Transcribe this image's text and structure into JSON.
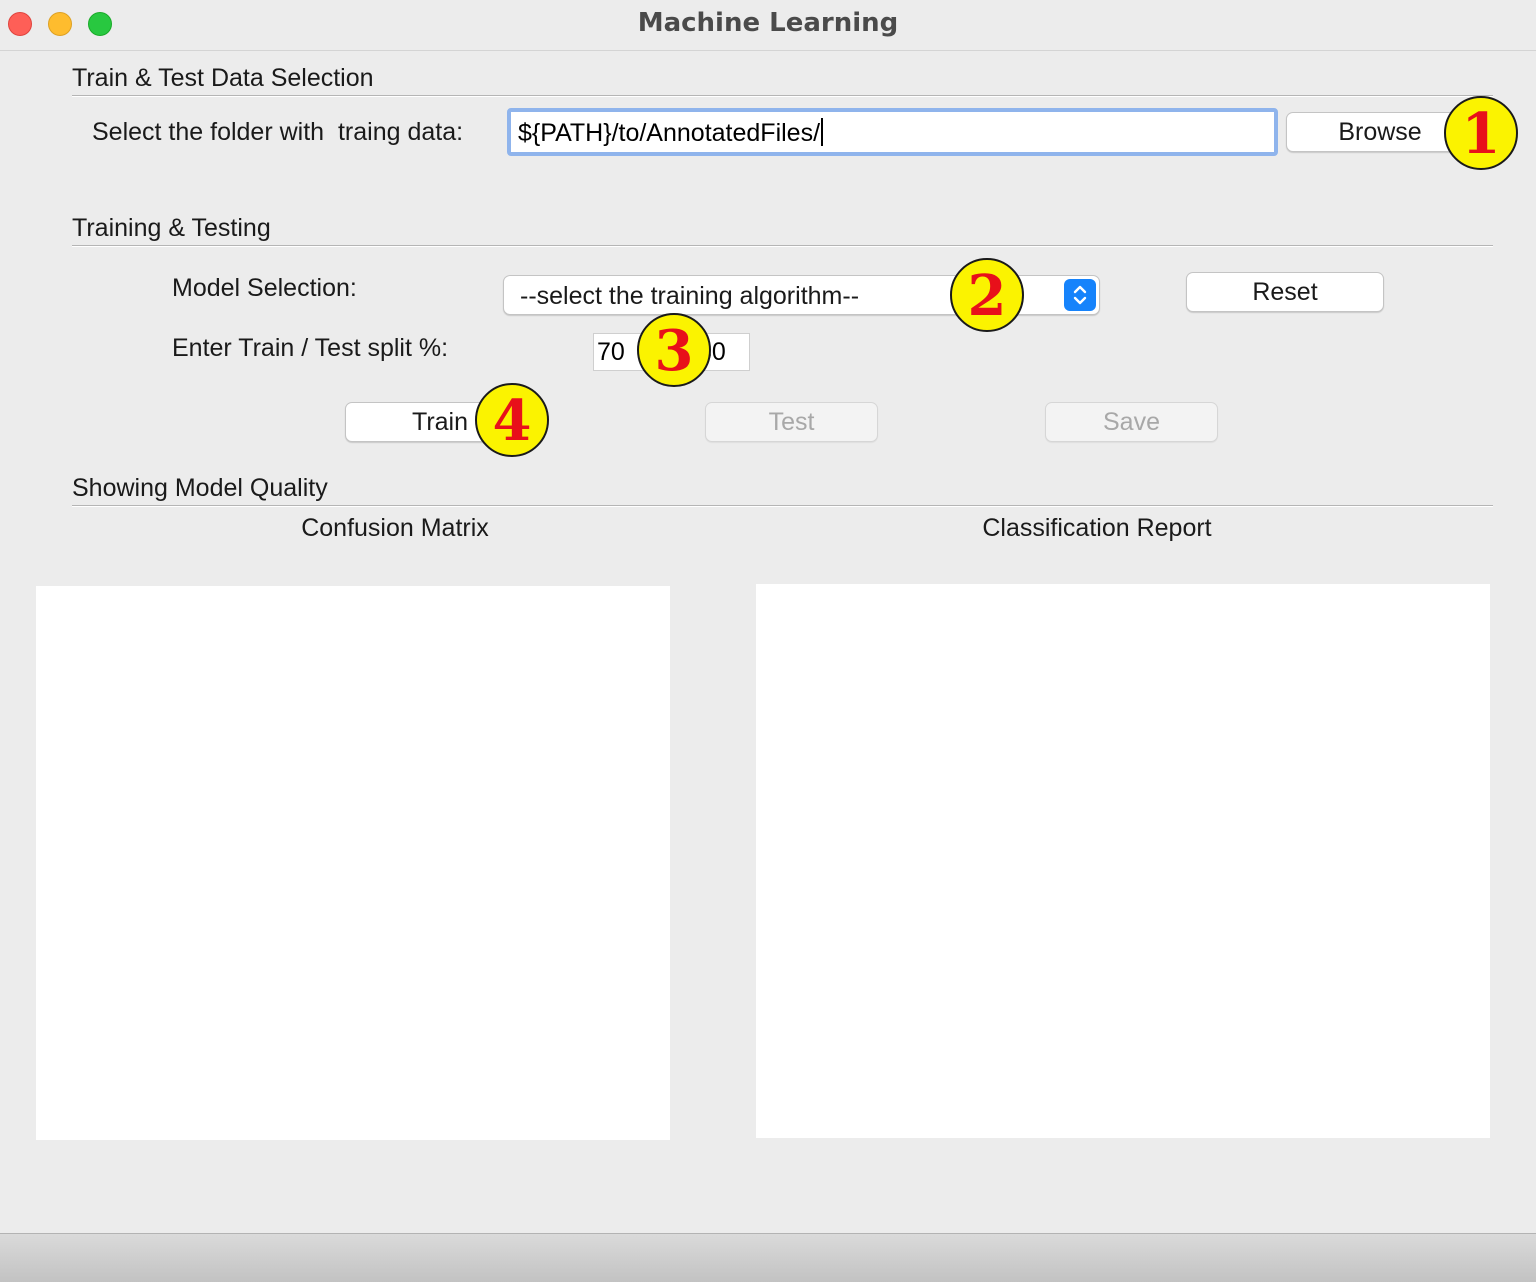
{
  "window": {
    "title": "Machine Learning"
  },
  "data_selection": {
    "section_title": "Train & Test Data Selection",
    "folder_label": "Select the folder with  traing data:",
    "folder_path": "${PATH}/to/AnnotatedFiles/",
    "browse_label": "Browse"
  },
  "training": {
    "section_title": "Training &  Testing",
    "model_label": "Model Selection:",
    "model_select_value": "--select the training algorithm--",
    "reset_label": "Reset",
    "split_label": "Enter Train / Test split %:",
    "train_split": "70",
    "test_split": "30",
    "train_label": "Train",
    "test_label": "Test",
    "save_label": "Save"
  },
  "quality": {
    "section_title": "Showing Model Quality",
    "confusion_title": "Confusion Matrix",
    "report_title": "Classification Report"
  },
  "badges": [
    "1",
    "2",
    "3",
    "4"
  ],
  "colors": {
    "badge_fill": "#fbf300",
    "badge_text": "#e8101a",
    "focus_ring": "#8fb4ec",
    "select_accent": "#1683fb"
  },
  "icons": [
    "close-icon",
    "minimize-icon",
    "maximize-icon",
    "select-arrows-icon"
  ]
}
